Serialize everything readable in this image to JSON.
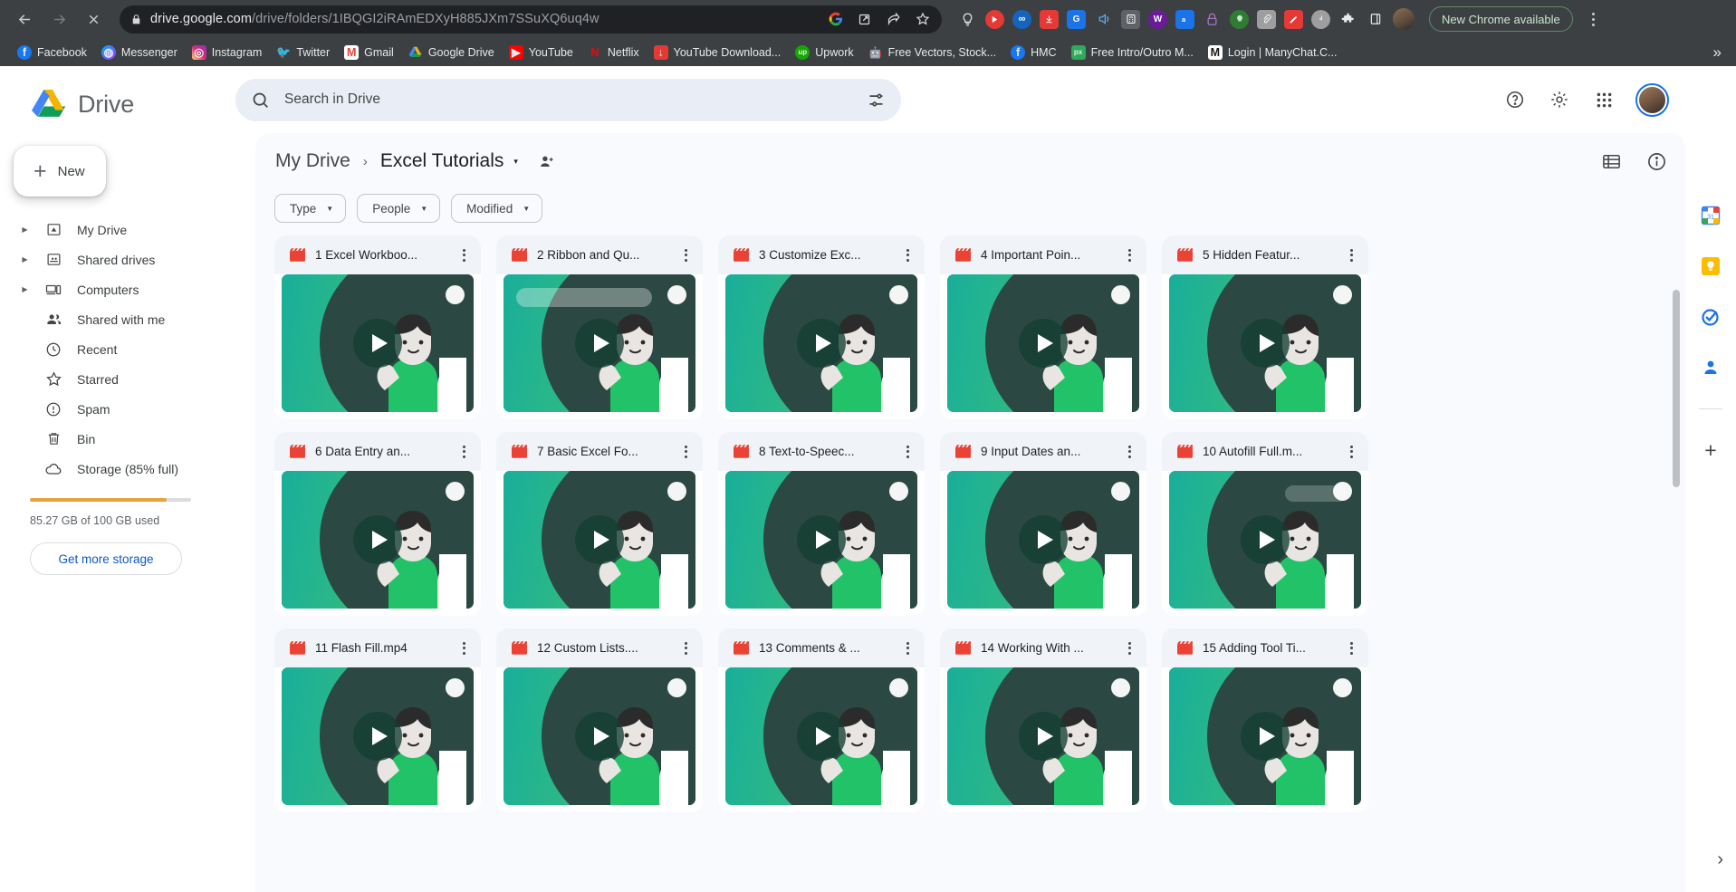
{
  "browser": {
    "url_host": "drive.google.com",
    "url_path": "/drive/folders/1IBQGI2iRAmEDXyH885JXm7SSuXQ6uq4w",
    "back_icon": "back-arrow-icon",
    "forward_icon": "forward-arrow-icon",
    "stop_icon": "stop-loading-icon",
    "lock_icon": "lock-icon",
    "update_pill": "New Chrome available",
    "omni_icons": [
      "google-icon",
      "open-in-new-icon",
      "share-icon",
      "bookmark-star-icon"
    ],
    "extensions": [
      {
        "name": "lightbulb-extension",
        "color": "#3c4043",
        "glyph": "Ὂ1"
      },
      {
        "name": "red-arrow-extension",
        "color": "#e53935",
        "glyph": ""
      },
      {
        "name": "infinity-extension",
        "color": "#1565c0",
        "glyph": ""
      },
      {
        "name": "downloader-extension",
        "color": "#e53935",
        "glyph": ""
      },
      {
        "name": "grammarly-extension",
        "color": "#1a73e8",
        "glyph": "G"
      },
      {
        "name": "sound-extension",
        "color": "#3c4043",
        "glyph": ""
      },
      {
        "name": "calculator-extension",
        "color": "#5f6368",
        "glyph": ""
      },
      {
        "name": "wordtune-extension",
        "color": "#6a1b9a",
        "glyph": "W"
      },
      {
        "name": "translate-extension",
        "color": "#1a73e8",
        "glyph": ""
      },
      {
        "name": "lock-extension",
        "color": "#7b1fa2",
        "glyph": ""
      },
      {
        "name": "idea-extension",
        "color": "#2e7d32",
        "glyph": ""
      },
      {
        "name": "clip-extension",
        "color": "#9e9e9e",
        "glyph": ""
      },
      {
        "name": "pen-extension",
        "color": "#e53935",
        "glyph": ""
      },
      {
        "name": "tiktok-extension",
        "color": "#9e9e9e",
        "glyph": ""
      },
      {
        "name": "puzzle-extensions-icon",
        "color": "#3c4043",
        "glyph": ""
      },
      {
        "name": "sidepanel-icon",
        "color": "#3c4043",
        "glyph": ""
      }
    ],
    "bookmarks": [
      {
        "label": "Facebook",
        "color": "#1877f2",
        "glyph": "f"
      },
      {
        "label": "Messenger",
        "color": "#a033ff",
        "glyph": ""
      },
      {
        "label": "Instagram",
        "color": "#d6249f",
        "glyph": ""
      },
      {
        "label": "Twitter",
        "color": "#1d9bf0",
        "glyph": ""
      },
      {
        "label": "Gmail",
        "color": "#ffffff",
        "glyph": "M"
      },
      {
        "label": "Google Drive",
        "color": "#ffffff",
        "glyph": ""
      },
      {
        "label": "YouTube",
        "color": "#ff0000",
        "glyph": ""
      },
      {
        "label": "Netflix",
        "color": "#141414",
        "glyph": "N"
      },
      {
        "label": "YouTube Download...",
        "color": "#e53935",
        "glyph": ""
      },
      {
        "label": "Upwork",
        "color": "#14a800",
        "glyph": "up"
      },
      {
        "label": "Free Vectors, Stock...",
        "color": "#3c4043",
        "glyph": ""
      },
      {
        "label": "HMC",
        "color": "#1877f2",
        "glyph": "f"
      },
      {
        "label": "Free Intro/Outro M...",
        "color": "#2eaa5a",
        "glyph": "px"
      },
      {
        "label": "Login | ManyChat.C...",
        "color": "#ffffff",
        "glyph": "M"
      }
    ],
    "bookmarks_overflow": "»"
  },
  "sidebar": {
    "app_name": "Drive",
    "new_button": "New",
    "items": [
      {
        "label": "My Drive",
        "icon": "my-drive-icon",
        "expandable": true
      },
      {
        "label": "Shared drives",
        "icon": "shared-drives-icon",
        "expandable": true
      },
      {
        "label": "Computers",
        "icon": "computers-icon",
        "expandable": true
      },
      {
        "label": "Shared with me",
        "icon": "shared-with-me-icon",
        "expandable": false
      },
      {
        "label": "Recent",
        "icon": "clock-icon",
        "expandable": false
      },
      {
        "label": "Starred",
        "icon": "star-icon",
        "expandable": false
      },
      {
        "label": "Spam",
        "icon": "spam-icon",
        "expandable": false
      },
      {
        "label": "Bin",
        "icon": "trash-icon",
        "expandable": false
      },
      {
        "label": "Storage (85% full)",
        "icon": "cloud-icon",
        "expandable": false
      }
    ],
    "storage_percent": 85,
    "storage_text": "85.27 GB of 100 GB used",
    "get_more_storage": "Get more storage"
  },
  "header": {
    "search_placeholder": "Search in Drive",
    "search_icon": "search-icon",
    "tune_icon": "search-options-icon",
    "help_icon": "help-icon",
    "settings_icon": "gear-icon",
    "apps_icon": "google-apps-grid-icon",
    "avatar": "user-avatar"
  },
  "breadcrumb": {
    "root": "My Drive",
    "separator": "›",
    "current": "Excel Tutorials",
    "caret": "▾",
    "share_icon": "add-people-icon",
    "list_view_icon": "list-view-icon",
    "details_icon": "view-details-icon"
  },
  "filters": [
    {
      "label": "Type",
      "name": "filter-chip-type"
    },
    {
      "label": "People",
      "name": "filter-chip-people"
    },
    {
      "label": "Modified",
      "name": "filter-chip-modified"
    }
  ],
  "files": [
    {
      "title": "1 Excel Workboo...",
      "type": "video",
      "variant": "plain"
    },
    {
      "title": "2 Ribbon and Qu...",
      "type": "video",
      "variant": "bar"
    },
    {
      "title": "3 Customize Exc...",
      "type": "video",
      "variant": "plain"
    },
    {
      "title": "4 Important Poin...",
      "type": "video",
      "variant": "plain"
    },
    {
      "title": "5 Hidden Featur...",
      "type": "video",
      "variant": "plain"
    },
    {
      "title": "6 Data Entry an...",
      "type": "video",
      "variant": "plain"
    },
    {
      "title": "7 Basic Excel Fo...",
      "type": "video",
      "variant": "plain"
    },
    {
      "title": "8 Text-to-Speec...",
      "type": "video",
      "variant": "plain"
    },
    {
      "title": "9 Input Dates an...",
      "type": "video",
      "variant": "plain"
    },
    {
      "title": "10 Autofill Full.m...",
      "type": "video",
      "variant": "smallbar"
    },
    {
      "title": "11 Flash Fill.mp4",
      "type": "video",
      "variant": "plain"
    },
    {
      "title": "12 Custom Lists....",
      "type": "video",
      "variant": "plain"
    },
    {
      "title": "13 Comments & ...",
      "type": "video",
      "variant": "plain"
    },
    {
      "title": "14 Working With ...",
      "type": "video",
      "variant": "plain"
    },
    {
      "title": "15 Adding Tool Ti...",
      "type": "video",
      "variant": "plain"
    }
  ],
  "right_rail": {
    "items": [
      {
        "name": "google-calendar-icon",
        "label": "31"
      },
      {
        "name": "google-keep-icon",
        "label": ""
      },
      {
        "name": "google-tasks-icon",
        "label": ""
      },
      {
        "name": "google-contacts-icon",
        "label": ""
      }
    ],
    "add_label": "+",
    "expand_label": "›"
  },
  "colors": {
    "brand_blue": "#1a73e8",
    "storage_orange": "#e8a33d",
    "video_red": "#ea4335",
    "panel_bg": "#f8fafd",
    "card_head": "#f0f4f9",
    "thumb_green_start": "#19ae9a",
    "thumb_green_end": "#47c95f"
  }
}
